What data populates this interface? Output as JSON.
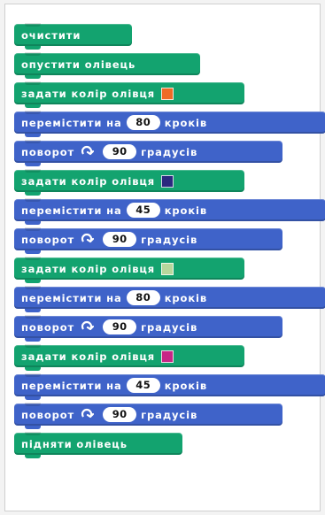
{
  "blocks": [
    {
      "label": "очистити"
    },
    {
      "label": "опустити олівець"
    },
    {
      "label": "задати колір олівця"
    },
    {
      "label": "перемістити на",
      "value": "80",
      "unit": "кроків"
    },
    {
      "label": "поворот",
      "value": "90",
      "unit": "градусів"
    },
    {
      "label": "задати колір олівця"
    },
    {
      "label": "перемістити на",
      "value": "45",
      "unit": "кроків"
    },
    {
      "label": "поворот",
      "value": "90",
      "unit": "градусів"
    },
    {
      "label": "задати колір олівця"
    },
    {
      "label": "перемістити на",
      "value": "80",
      "unit": "кроків"
    },
    {
      "label": "поворот",
      "value": "90",
      "unit": "градусів"
    },
    {
      "label": "задати колір олівця"
    },
    {
      "label": "перемістити на",
      "value": "45",
      "unit": "кроків"
    },
    {
      "label": "поворот",
      "value": "90",
      "unit": "градусів"
    },
    {
      "label": "підняти олівець"
    }
  ],
  "colors": {
    "pen_colors": [
      "#ef6a26",
      "#2b2a7f",
      "#b8d79c",
      "#c72686"
    ],
    "green_block": "#13a36f",
    "blue_block": "#3f63c9"
  },
  "icons": {
    "turn": "turn-clockwise-icon"
  }
}
